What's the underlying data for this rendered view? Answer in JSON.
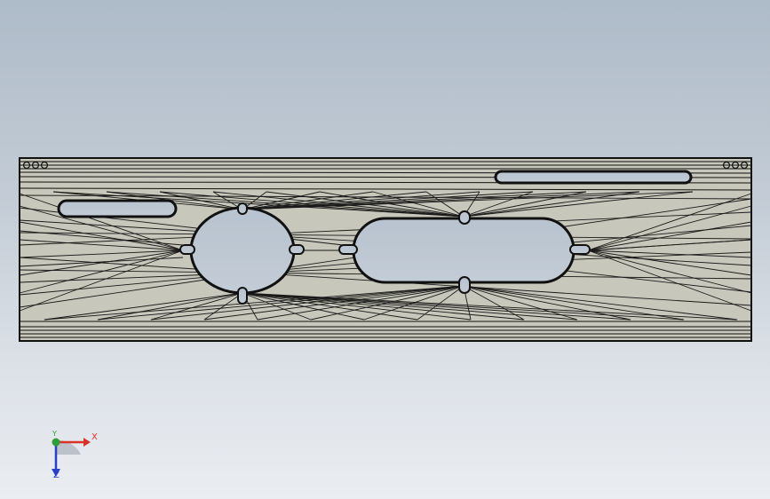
{
  "viewport": {
    "background_top": "#aebbc8",
    "background_bottom": "#eaedf1"
  },
  "model": {
    "face_color": "#c7c7bb",
    "edge_color": "#111111",
    "features": [
      "left-slot",
      "round-hole",
      "long-slot",
      "top-right-slot"
    ]
  },
  "triad": {
    "x_label": "X",
    "y_label": "Y",
    "z_label": "Z",
    "x_color": "#d8322a",
    "y_color": "#2e9d3a",
    "z_color": "#2a3fc6"
  }
}
